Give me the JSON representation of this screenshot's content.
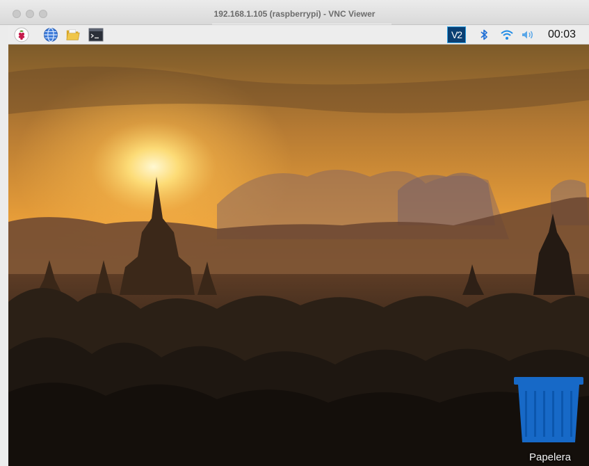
{
  "window": {
    "title": "192.168.1.105 (raspberrypi) - VNC Viewer"
  },
  "panel": {
    "launchers": [
      {
        "name": "raspberry-menu-icon"
      },
      {
        "name": "web-browser-icon"
      },
      {
        "name": "file-manager-icon"
      },
      {
        "name": "terminal-icon"
      }
    ],
    "tray": {
      "vnc_label": "V2",
      "clock": "00:03"
    }
  },
  "desktop": {
    "trash_label": "Papelera"
  },
  "colors": {
    "trash_blue": "#1769c7",
    "vnc_blue": "#0a3f73",
    "sky_glow": "#f7b54a"
  }
}
